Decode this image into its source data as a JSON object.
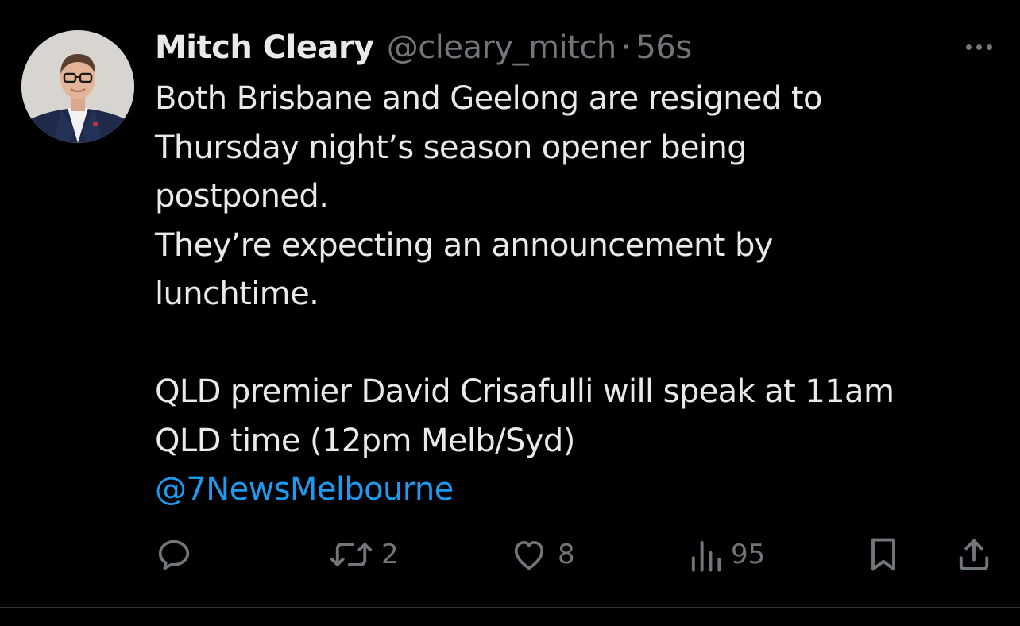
{
  "tweet": {
    "author": {
      "display_name": "Mitch Cleary",
      "handle": "@cleary_mitch",
      "separator": "·",
      "time": "56s"
    },
    "body_lines": [
      "Both Brisbane and Geelong are resigned to",
      "Thursday night’s season opener being",
      "postponed.",
      "They’re expecting an announcement by",
      "lunchtime.",
      "",
      "QLD premier David Crisafulli will speak at 11am",
      "QLD time (12pm Melb/Syd)"
    ],
    "mention": "@7NewsMelbourne",
    "actions": {
      "reply": {
        "icon": "reply-icon"
      },
      "retweet": {
        "icon": "retweet-icon",
        "count": "2"
      },
      "like": {
        "icon": "heart-icon",
        "count": "8"
      },
      "views": {
        "icon": "views-icon",
        "count": "95"
      },
      "bookmark": {
        "icon": "bookmark-icon"
      },
      "share": {
        "icon": "share-icon"
      }
    }
  },
  "colors": {
    "background": "#000000",
    "text": "#e7e9ea",
    "muted": "#71767b",
    "accent": "#1d9bf0",
    "divider": "#2f3336"
  }
}
